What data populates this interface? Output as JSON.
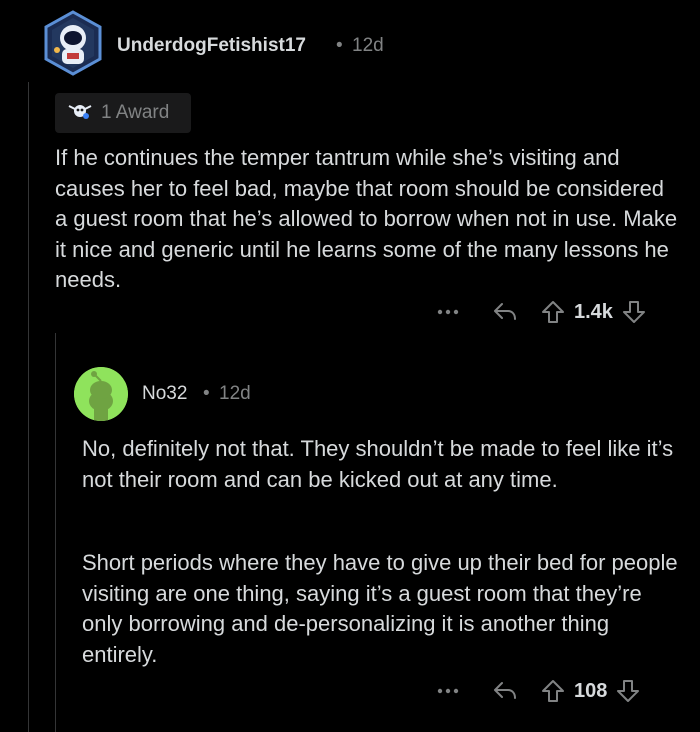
{
  "comment1": {
    "username": "UnderdogFetishist17",
    "separator": "•",
    "age": "12d",
    "award_label": "1 Award",
    "body": "If he continues the temper tantrum while she’s visiting and causes her to feel bad, maybe that room should be considered a guest room that he’s allowed to borrow when not in use. Make it nice and generic until he learns some of the many lessons he needs.",
    "score": "1.4k",
    "icons": {
      "more": "more-icon",
      "reply": "reply-icon",
      "upvote": "upvote-icon",
      "downvote": "downvote-icon",
      "avatar": "astronaut-avatar",
      "award": "award-icon"
    }
  },
  "comment2": {
    "username": "No32",
    "separator": "•",
    "age": "12d",
    "paragraph1": "No, definitely not that. They shouldn’t be made to feel like it’s not their room and can be kicked out at any time.",
    "paragraph2": "Short periods where they have to give up their bed for people visiting are one thing, saying it’s a guest room that they’re only borrowing and de-personalizing it is another thing entirely.",
    "score": "108",
    "icons": {
      "more": "more-icon",
      "reply": "reply-icon",
      "upvote": "upvote-icon",
      "downvote": "downvote-icon",
      "avatar": "snoo-avatar"
    }
  },
  "colors": {
    "background": "#000000",
    "text": "#d7dadc",
    "meta": "#818384",
    "award_bg": "#1a1a1b",
    "avatar2_bg": "#8fe35c",
    "avatar1_frame": "#5b8fd6"
  }
}
